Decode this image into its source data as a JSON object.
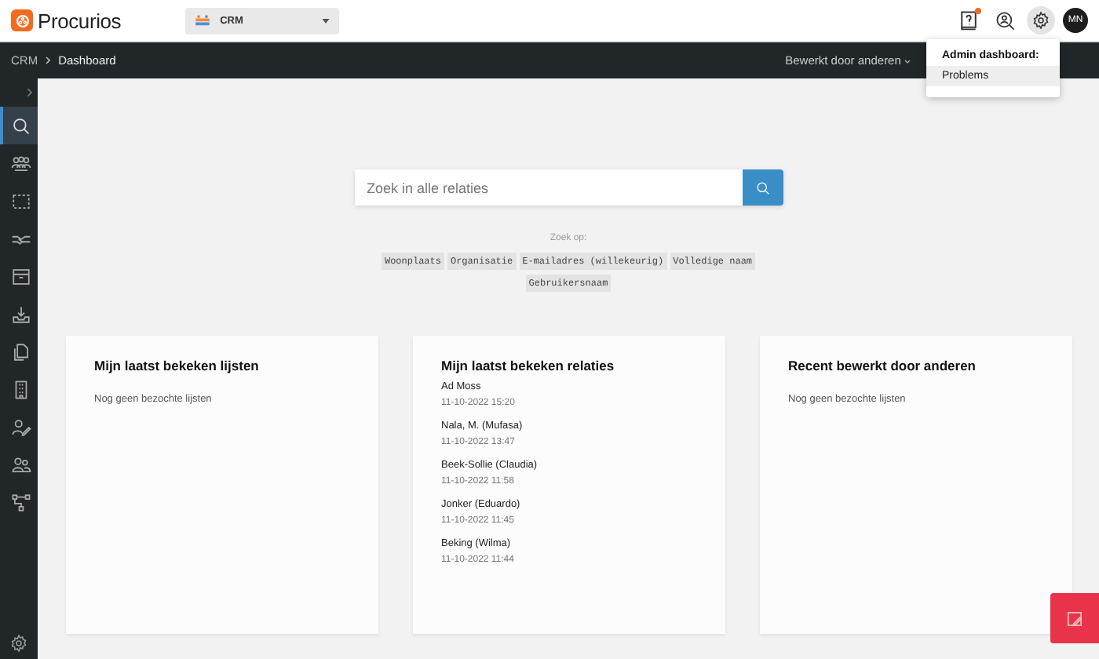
{
  "header": {
    "brand": "Procurios",
    "app_selector": {
      "value": "CRM"
    },
    "notification": true,
    "avatar": "MN"
  },
  "breadcrumb": [
    "CRM",
    "Dashboard"
  ],
  "filter": {
    "label": "Bewerkt door anderen"
  },
  "admin_menu": {
    "heading": "Admin dashboard:",
    "items": [
      {
        "label": "Problems",
        "selected": true
      }
    ]
  },
  "sidebar": {
    "items": [
      {
        "kind": "search",
        "selected": true
      },
      {
        "kind": "group",
        "selected": false
      },
      {
        "kind": "selection",
        "selected": false
      },
      {
        "kind": "handshake",
        "selected": false
      },
      {
        "kind": "archive",
        "selected": false
      },
      {
        "kind": "tray",
        "selected": false
      },
      {
        "kind": "documents",
        "selected": false
      },
      {
        "kind": "building",
        "selected": false
      },
      {
        "kind": "user-edit",
        "selected": false
      },
      {
        "kind": "users",
        "selected": false
      },
      {
        "kind": "flow",
        "selected": false
      }
    ]
  },
  "search": {
    "placeholder": "Zoek in alle relaties",
    "hint": "Zoek op:",
    "fields": [
      "Woonplaats",
      "Organisatie",
      "E-mailadres (willekeurig)",
      "Volledige naam",
      "Gebruikersnaam"
    ]
  },
  "cards": [
    {
      "title": "Mijn laatst bekeken lijsten",
      "empty": "Nog geen bezochte lijsten"
    },
    {
      "title": "Mijn laatst bekeken relaties",
      "entries": [
        {
          "name": "Ad Moss",
          "time": "11-10-2022 15:20"
        },
        {
          "name": "Nala, M. (Mufasa)",
          "time": "11-10-2022 13:47"
        },
        {
          "name": "Beek-Sollie (Claudia)",
          "time": "11-10-2022 11:58"
        },
        {
          "name": "Jonker (Eduardo)",
          "time": "11-10-2022 11:45"
        },
        {
          "name": "Beking (Wilma)",
          "time": "11-10-2022 11:44"
        }
      ]
    },
    {
      "title": "Recent bewerkt door anderen",
      "empty": "Nog geen bezochte lijsten"
    }
  ]
}
